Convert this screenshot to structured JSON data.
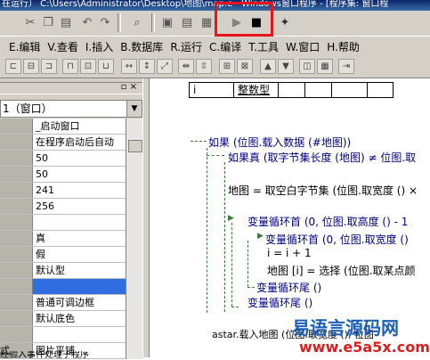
{
  "window": {
    "title": "在运行）   C:\\Users\\Administrator\\Desktop\\地图\\map.e - Windows窗口程序 - [程序集: 窗口程"
  },
  "toolbar": {
    "run_icon": "play-icon",
    "stop_icon": "stop-icon"
  },
  "menu": [
    {
      "label": "E.编辑"
    },
    {
      "label": "V.查看"
    },
    {
      "label": "I.插入"
    },
    {
      "label": "B.数据库"
    },
    {
      "label": "R.运行"
    },
    {
      "label": "C.编译"
    },
    {
      "label": "T.工具"
    },
    {
      "label": "W.窗口"
    },
    {
      "label": "H.帮助"
    }
  ],
  "left_panel": {
    "combo_value": "1（窗口）",
    "properties": [
      {
        "name": "",
        "value": "_启动窗口"
      },
      {
        "name": "",
        "value": "在程序启动后自动"
      },
      {
        "name": "",
        "value": "50"
      },
      {
        "name": "",
        "value": "50"
      },
      {
        "name": "",
        "value": "241"
      },
      {
        "name": "",
        "value": "256"
      },
      {
        "name": "",
        "value": ""
      },
      {
        "name": "",
        "value": "真"
      },
      {
        "name": "",
        "value": "假"
      },
      {
        "name": "",
        "value": "默认型"
      },
      {
        "name": "",
        "value": ""
      },
      {
        "name": "",
        "value": "普通可调边框"
      },
      {
        "name": "",
        "value": "默认底色"
      },
      {
        "name": "",
        "value": ""
      },
      {
        "name": "式",
        "value": "图片平铺"
      }
    ],
    "bottom_text": "经验入事件处理子程序"
  },
  "var_table": {
    "name": "i",
    "type": "整数型"
  },
  "code_lines": [
    "如果 (位图.载入数据 (#地图))",
    "如果真 (取字节集长度 (地图) ≠ 位图.取",
    "地图 = 取空白字节集 (位图.取宽度 () ×",
    "变量循环首 (0, 位图.取高度 () - 1",
    "变量循环首 (0, 位图.取宽度 ()",
    "i = i + 1",
    "地图 [i] = 选择 (位图.取某点颜",
    "变量循环尾 ()",
    "变量循环尾 ()",
    "astar.载入地图 (位图.取宽度 (), 位图"
  ],
  "watermark": {
    "line1": "易语言源码网",
    "line2": "www.e5a5x.com"
  }
}
